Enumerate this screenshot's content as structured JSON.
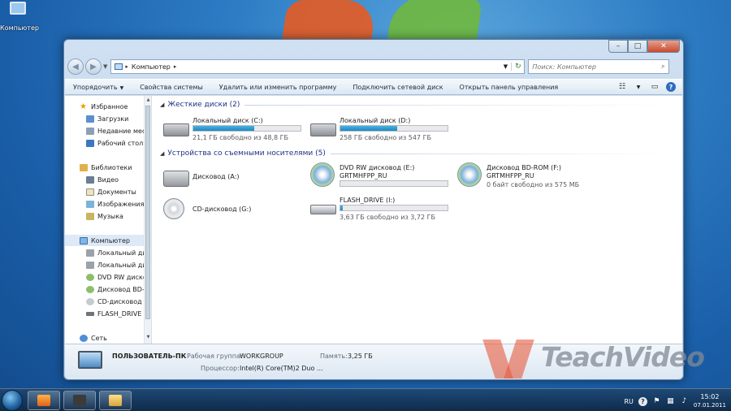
{
  "desktop": {
    "icon_label": "Компьютер"
  },
  "window": {
    "caption_buttons": {
      "minimize": "–",
      "maximize": "□",
      "close": "✕"
    },
    "address": {
      "crumb": "Компьютер",
      "separator": "▸"
    },
    "search": {
      "placeholder": "Поиск: Компьютер"
    },
    "toolbar": {
      "organize": "Упорядочить",
      "system_properties": "Свойства системы",
      "uninstall": "Удалить или изменить программу",
      "map_drive": "Подключить сетевой диск",
      "control_panel": "Открыть панель управления"
    },
    "nav": {
      "favorites": "Избранное",
      "downloads": "Загрузки",
      "recent": "Недавние места",
      "desktop": "Рабочий стол",
      "libraries": "Библиотеки",
      "videos": "Видео",
      "documents": "Документы",
      "pictures": "Изображения",
      "music": "Музыка",
      "computer": "Компьютер",
      "local_c": "Локальный диск (C:)",
      "local_d": "Локальный диск (D:)",
      "dvd_e": "DVD RW дисковод (E:)",
      "bd_f": "Дисковод BD-ROM (F:)",
      "cd_g": "CD-дисковод (G:)",
      "flash_i": "FLASH_DRIVE (I:)",
      "network": "Сеть"
    },
    "sections": {
      "hard_drives": "Жесткие диски (2)",
      "removable": "Устройства со съемными носителями (5)"
    },
    "drives": {
      "c": {
        "name": "Локальный диск (C:)",
        "free": "21,1 ГБ свободно из 48,8 ГБ",
        "used_fraction": 0.57
      },
      "d": {
        "name": "Локальный диск (D:)",
        "free": "258 ГБ свободно из 547 ГБ",
        "used_fraction": 0.53
      },
      "a": {
        "name": "Дисковод (A:)"
      },
      "e": {
        "name": "DVD RW дисковод (E:)",
        "label": "GRTMHFPP_RU",
        "used_fraction": 0.0
      },
      "f": {
        "name": "Дисковод BD-ROM (F:)",
        "label": "GRTMHFPP_RU",
        "free": "0 байт свободно из 575 МБ"
      },
      "g": {
        "name": "CD-дисковод (G:)"
      },
      "i": {
        "name": "FLASH_DRIVE (I:)",
        "free": "3,63 ГБ свободно из 3,72 ГБ",
        "used_fraction": 0.025
      }
    },
    "details": {
      "computer_name": "ПОЛЬЗОВАТЕЛЬ-ПК",
      "workgroup_label": "Рабочая группа:",
      "workgroup": "WORKGROUP",
      "memory_label": "Память:",
      "memory": "3,25 ГБ",
      "cpu_label": "Процессор:",
      "cpu": "Intel(R) Core(TM)2 Duo ..."
    }
  },
  "watermark": "TeachVideo",
  "taskbar": {
    "language": "RU",
    "time": "15:02",
    "date": "07.01.2011"
  },
  "colors": {
    "progress": "#1f86c3",
    "section_title": "#1e3287",
    "close_button": "#c74a2c"
  }
}
